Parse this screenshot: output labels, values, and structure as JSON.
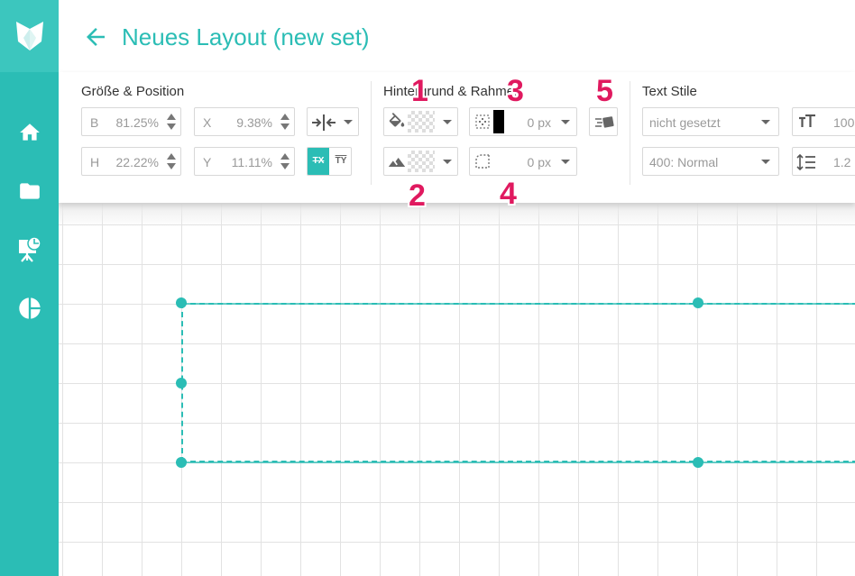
{
  "header": {
    "title": "Neues Layout (new set)"
  },
  "toolbar": {
    "size_position": {
      "title": "Größe & Position",
      "width": {
        "label": "B",
        "value": "81.25",
        "unit": "%"
      },
      "height": {
        "label": "H",
        "value": "22.22",
        "unit": "%"
      },
      "x": {
        "label": "X",
        "value": "9.38",
        "unit": "%"
      },
      "y": {
        "label": "Y",
        "value": "11.11",
        "unit": "%"
      },
      "text_toggle_a": "TX",
      "text_toggle_b": "TY"
    },
    "background_border": {
      "title": "Hintergrund & Rahmen",
      "border_width": "0 px",
      "radius": "0 px"
    },
    "text_styles": {
      "title": "Text Stile",
      "style_select": "nicht gesetzt",
      "weight_select": "400: Normal",
      "font_size": "100",
      "line_height": "1.2"
    }
  },
  "annotations": {
    "n1": "1",
    "n2": "2",
    "n3": "3",
    "n4": "4",
    "n5": "5"
  },
  "colors": {
    "accent": "#2bbdb5",
    "annotation": "#e0195f"
  },
  "icons": {
    "sidebar": [
      "fox-logo-icon",
      "home-icon",
      "folder-icon",
      "presentation-icon",
      "pie-chart-icon"
    ]
  }
}
